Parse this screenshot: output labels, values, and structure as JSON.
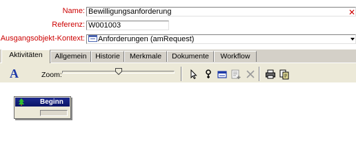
{
  "form": {
    "name_label": "Name:",
    "name_value": "Bewilligungsanforderung",
    "ref_label": "Referenz:",
    "ref_value": "W001003",
    "context_label": "Ausgangsobjekt-Kontext:",
    "context_value": "Anforderungen (amRequest)"
  },
  "tabs": [
    {
      "label": "Aktivitäten",
      "active": true
    },
    {
      "label": "Allgemein"
    },
    {
      "label": "Historie"
    },
    {
      "label": "Merkmale"
    },
    {
      "label": "Dokumente"
    },
    {
      "label": "Workflow"
    }
  ],
  "toolbar": {
    "font_glyph": "A",
    "zoom_label": "Zoom:",
    "zoom_level": 0.5,
    "icons": [
      "select-arrow-icon",
      "link-icon",
      "rectangle-icon",
      "add-activity-icon",
      "delete-icon",
      "print-icon",
      "copy-icon"
    ]
  },
  "canvas": {
    "node": {
      "title": "Beginn"
    }
  },
  "colors": {
    "label_red": "#cc0000",
    "node_header": "#0a1466",
    "panel": "#ece9d8",
    "tab_bg": "#d4d0c8"
  }
}
